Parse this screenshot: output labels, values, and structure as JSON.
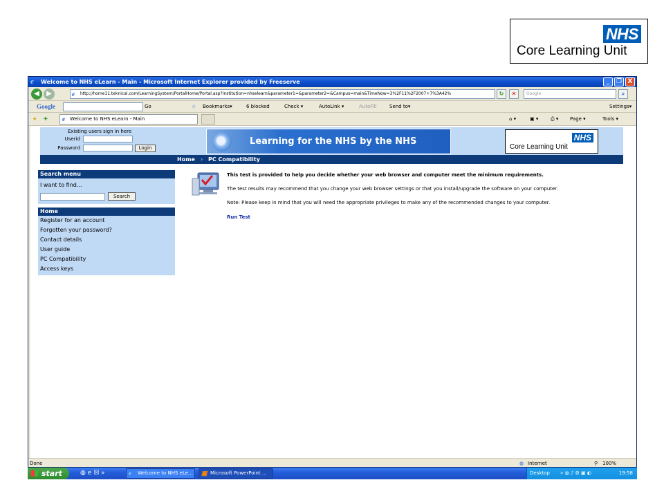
{
  "slide": {
    "logo_nhs": "NHS",
    "logo_text": "Core Learning Unit"
  },
  "window": {
    "title": "Welcome to NHS eLearn - Main - Microsoft Internet Explorer provided by Freeserve",
    "controls": [
      "_",
      "❐",
      "X"
    ]
  },
  "address_bar": {
    "url": "http://home11.teknical.com/LearningSystem/PortalHome/Portal.asp?Institution=nhselearn&parameter1=&parameter2=&Campus=main&TimeNow=3%2F11%2F2007+7%3A42%",
    "search_placeholder": "Google"
  },
  "google_toolbar": {
    "logo": "Google",
    "go_label": "Go",
    "bookmarks_label": "Bookmarks▾",
    "blocked_label": "6 blocked",
    "check_label": "Check ▾",
    "autolink_label": "AutoLink ▾",
    "autofill_label": "AutoFill",
    "sendto_label": "Send to▾",
    "settings_label": "Settings▾"
  },
  "tabs": {
    "active_tab": "Welcome to NHS eLearn - Main",
    "page_label": "Page ▾",
    "tools_label": "Tools ▾"
  },
  "site": {
    "signin_title": "Existing users sign in here",
    "userid_label": "Userid",
    "password_label": "Password",
    "login_label": "Login",
    "banner_text": "Learning for the NHS by the NHS",
    "logo_nhs": "NHS",
    "logo_text": "Core Learning Unit",
    "breadcrumb": [
      "Home",
      "PC Compatibility"
    ],
    "breadcrumb_sep": "›"
  },
  "search_menu": {
    "heading": "Search menu",
    "prompt": "I want to find...",
    "button": "Search"
  },
  "home_menu": {
    "heading": "Home",
    "items": [
      {
        "label": "Register for an account"
      },
      {
        "label": "Forgotten your password?"
      },
      {
        "label": "Contact details"
      },
      {
        "label": "User guide"
      },
      {
        "label": "PC Compatibility"
      },
      {
        "label": "Access keys"
      }
    ]
  },
  "content": {
    "intro": "This test is provided to help you decide whether your web browser and computer meet the minimum requirements.",
    "results_note": "The test results may recommend that you change your web browser settings or that you install/upgrade the software on your computer.",
    "privileges_note": "Note: Please keep in mind that you will need the appropriate privileges to make any of the recommended changes to your computer.",
    "run_test": "Run Test"
  },
  "status_bar": {
    "status": "Done",
    "zone": "Internet",
    "zoom": "100%"
  },
  "taskbar": {
    "start": "start",
    "tasks": [
      {
        "label": "Welcome to NHS eLe..."
      },
      {
        "label": "Microsoft PowerPoint ..."
      }
    ],
    "desktop": "Desktop",
    "time": "19:58"
  }
}
